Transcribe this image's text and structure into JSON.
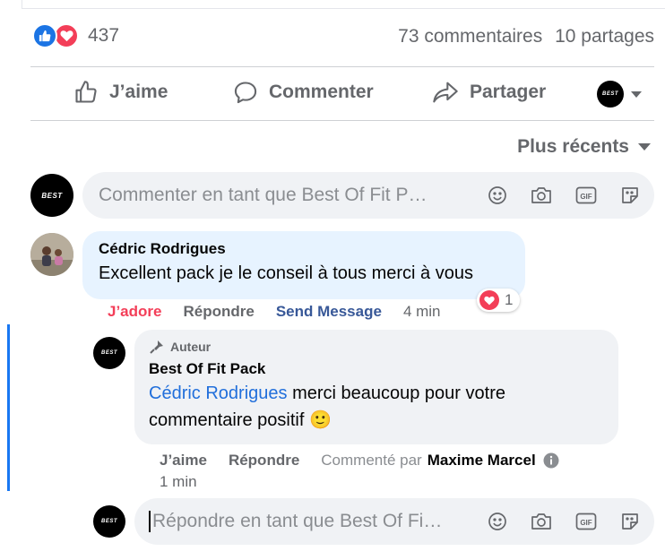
{
  "reactions": {
    "count": "437"
  },
  "stats": {
    "comments": "73 commentaires",
    "shares": "10 partages"
  },
  "actions": {
    "like": "J’aime",
    "comment": "Commenter",
    "share": "Partager"
  },
  "sort": {
    "label": "Plus récents"
  },
  "composer": {
    "placeholder": "Commenter en tant que Best Of Fit P…"
  },
  "page_logo_text": "BEST",
  "comment1": {
    "author": "Cédric Rodrigues",
    "text": "Excellent pack je le conseil à tous merci à vous",
    "reaction_count": "1",
    "actions": {
      "react": "J’adore",
      "reply": "Répondre",
      "message": "Send Message",
      "time": "4 min"
    }
  },
  "reply1": {
    "badge": "Auteur",
    "author": "Best Of Fit Pack",
    "mention": "Cédric Rodrigues",
    "text": " merci beaucoup pour votre commentaire positif",
    "emoji": "🙂",
    "actions": {
      "like": "J’aime",
      "reply": "Répondre",
      "commented_by_prefix": "Commenté par",
      "commented_by": "Maxime Marcel",
      "time": "1 min"
    }
  },
  "reply_composer": {
    "placeholder": "Répondre en tant que Best Of Fi…"
  },
  "colors": {
    "facebook_blue": "#1877f2",
    "love_red": "#f33e58",
    "bubble_blue": "#e7f3ff",
    "bubble_grey": "#f0f2f5"
  }
}
